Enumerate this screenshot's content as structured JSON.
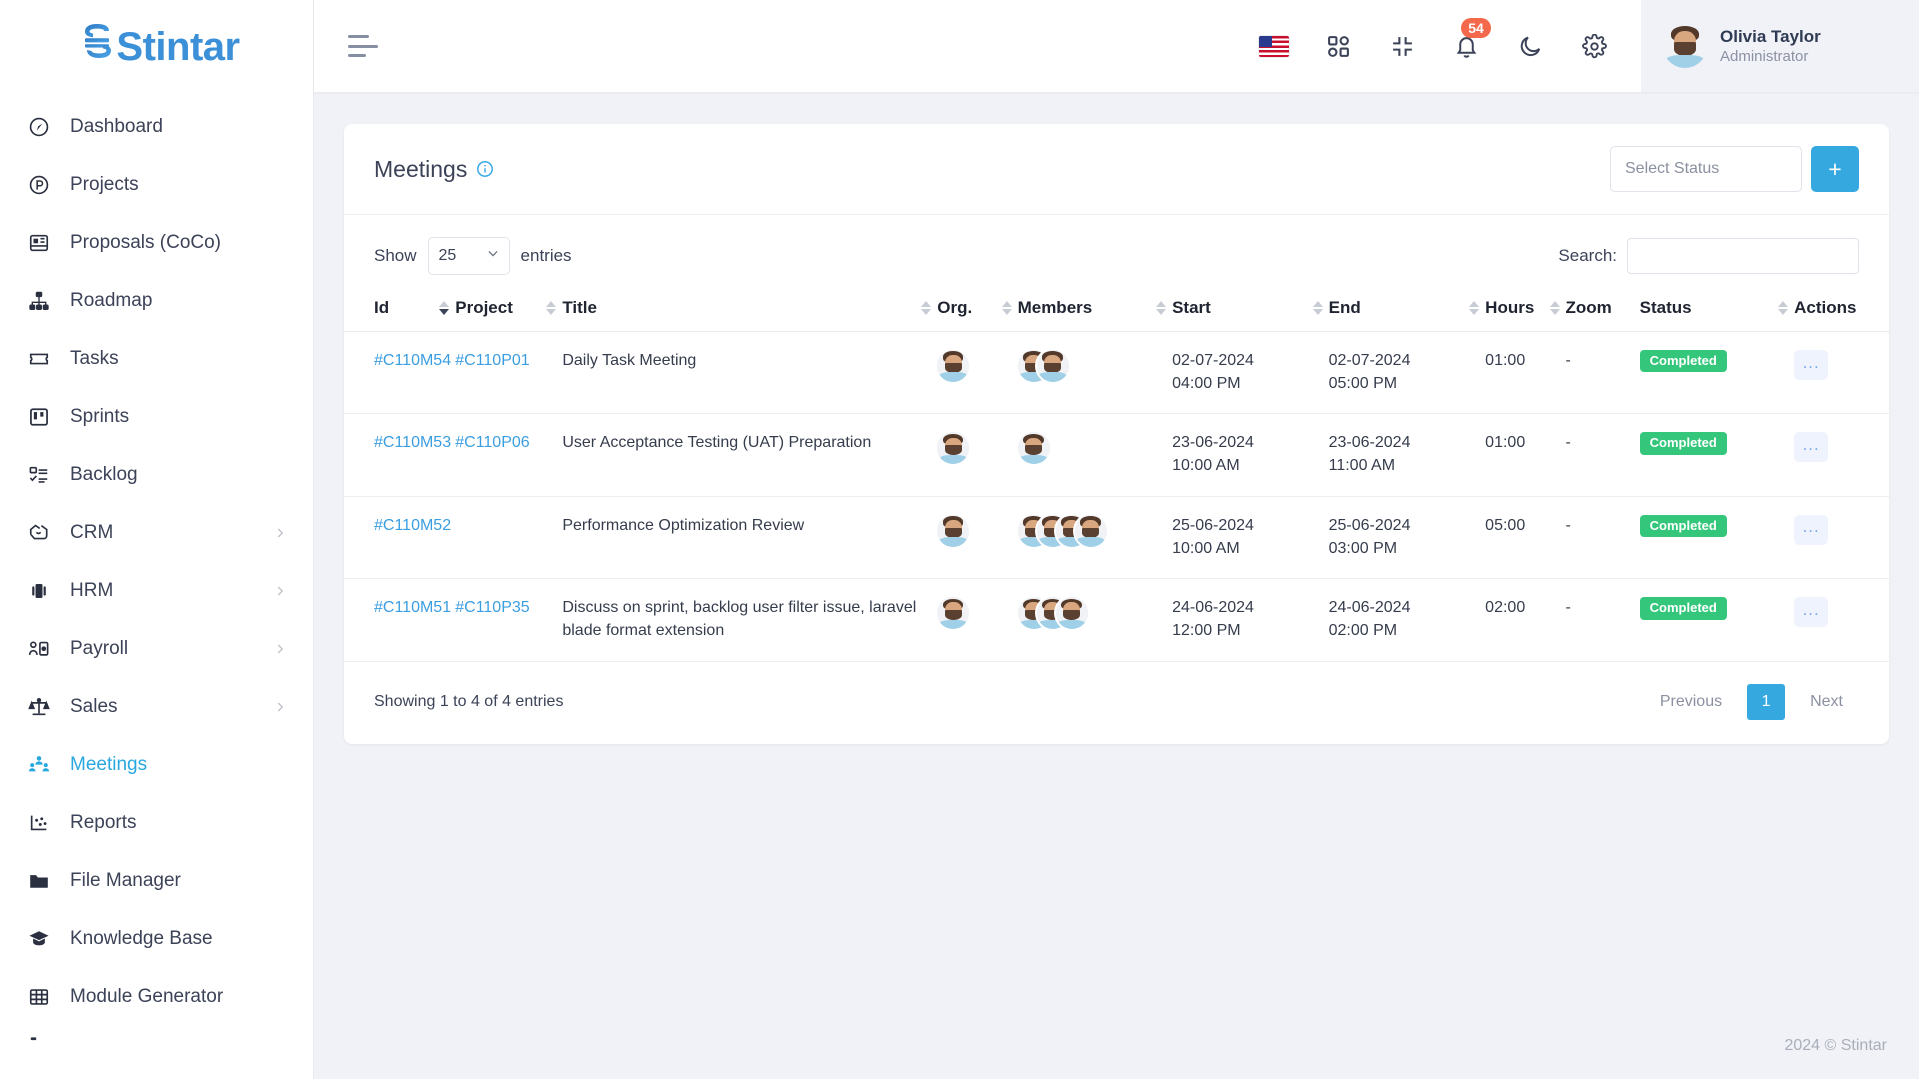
{
  "brand": {
    "name": "Stintar",
    "accent": "#35a8e0"
  },
  "sidebar": {
    "items": [
      {
        "label": "Dashboard",
        "icon": "gauge-icon",
        "active": false,
        "has_chevron": false
      },
      {
        "label": "Projects",
        "icon": "circle-p-icon",
        "active": false,
        "has_chevron": false
      },
      {
        "label": "Proposals (CoCo)",
        "icon": "layout-panel-icon",
        "active": false,
        "has_chevron": false
      },
      {
        "label": "Roadmap",
        "icon": "hierarchy-icon",
        "active": false,
        "has_chevron": false
      },
      {
        "label": "Tasks",
        "icon": "ticket-icon",
        "active": false,
        "has_chevron": false
      },
      {
        "label": "Sprints",
        "icon": "kanban-icon",
        "active": false,
        "has_chevron": false
      },
      {
        "label": "Backlog",
        "icon": "checklist-icon",
        "active": false,
        "has_chevron": false
      },
      {
        "label": "CRM",
        "icon": "handshake-icon",
        "active": false,
        "has_chevron": true
      },
      {
        "label": "HRM",
        "icon": "id-card-icon",
        "active": false,
        "has_chevron": true
      },
      {
        "label": "Payroll",
        "icon": "user-money-icon",
        "active": false,
        "has_chevron": true
      },
      {
        "label": "Sales",
        "icon": "scales-icon",
        "active": false,
        "has_chevron": true
      },
      {
        "label": "Meetings",
        "icon": "people-group-icon",
        "active": true,
        "has_chevron": false
      },
      {
        "label": "Reports",
        "icon": "scatter-chart-icon",
        "active": false,
        "has_chevron": false
      },
      {
        "label": "File Manager",
        "icon": "folder-icon",
        "active": false,
        "has_chevron": false
      },
      {
        "label": "Knowledge Base",
        "icon": "graduation-cap-icon",
        "active": false,
        "has_chevron": false
      },
      {
        "label": "Module Generator",
        "icon": "grid-table-icon",
        "active": false,
        "has_chevron": false
      }
    ]
  },
  "topbar": {
    "menu_toggle": "hamburger-icon",
    "language_flag": "us-flag-icon",
    "apps_icon": "apps-grid-icon",
    "fullscreen_icon": "compress-icon",
    "notifications_icon": "bell-icon",
    "notifications_count": "54",
    "theme_icon": "moon-icon",
    "settings_icon": "gear-icon",
    "user": {
      "name": "Olivia Taylor",
      "role": "Administrator",
      "avatar": "user-avatar"
    }
  },
  "page": {
    "title": "Meetings",
    "info_icon": "info-circle-icon",
    "status_filter_placeholder": "Select Status",
    "add_button_label": "+"
  },
  "table_controls": {
    "show_label": "Show",
    "entries_value": "25",
    "entries_label": "entries",
    "search_label": "Search:",
    "search_value": ""
  },
  "table": {
    "columns": [
      {
        "label": "Id",
        "sortable": true,
        "sort": "desc"
      },
      {
        "label": "Project",
        "sortable": true,
        "sort": "none"
      },
      {
        "label": "Title",
        "sortable": true,
        "sort": "none"
      },
      {
        "label": "Org.",
        "sortable": true,
        "sort": "none"
      },
      {
        "label": "Members",
        "sortable": true,
        "sort": "none"
      },
      {
        "label": "Start",
        "sortable": true,
        "sort": "none"
      },
      {
        "label": "End",
        "sortable": true,
        "sort": "none"
      },
      {
        "label": "Hours",
        "sortable": true,
        "sort": "none"
      },
      {
        "label": "Zoom",
        "sortable": false,
        "sort": "none"
      },
      {
        "label": "Status",
        "sortable": true,
        "sort": "none"
      },
      {
        "label": "Actions",
        "sortable": false,
        "sort": "none"
      }
    ],
    "rows": [
      {
        "id": "#C110M54",
        "project": "#C110P01",
        "title": "Daily Task Meeting",
        "org_count": 1,
        "member_count": 2,
        "start_date": "02-07-2024",
        "start_time": "04:00 PM",
        "end_date": "02-07-2024",
        "end_time": "05:00 PM",
        "hours": "01:00",
        "zoom": "-",
        "status": "Completed",
        "actions": "..."
      },
      {
        "id": "#C110M53",
        "project": "#C110P06",
        "title": "User Acceptance Testing (UAT) Preparation",
        "org_count": 1,
        "member_count": 1,
        "start_date": "23-06-2024",
        "start_time": "10:00 AM",
        "end_date": "23-06-2024",
        "end_time": "11:00 AM",
        "hours": "01:00",
        "zoom": "-",
        "status": "Completed",
        "actions": "..."
      },
      {
        "id": "#C110M52",
        "project": "",
        "title": "Performance Optimization Review",
        "org_count": 1,
        "member_count": 4,
        "start_date": "25-06-2024",
        "start_time": "10:00 AM",
        "end_date": "25-06-2024",
        "end_time": "03:00 PM",
        "hours": "05:00",
        "zoom": "-",
        "status": "Completed",
        "actions": "..."
      },
      {
        "id": "#C110M51",
        "project": "#C110P35",
        "title": "Discuss on sprint, backlog user filter issue, laravel blade format extension",
        "org_count": 1,
        "member_count": 3,
        "start_date": "24-06-2024",
        "start_time": "12:00 PM",
        "end_date": "24-06-2024",
        "end_time": "02:00 PM",
        "hours": "02:00",
        "zoom": "-",
        "status": "Completed",
        "actions": "..."
      }
    ]
  },
  "table_footer": {
    "showing": "Showing 1 to 4 of 4 entries",
    "previous_label": "Previous",
    "page_label": "1",
    "next_label": "Next"
  },
  "footer": {
    "copyright": "2024 © Stintar"
  }
}
